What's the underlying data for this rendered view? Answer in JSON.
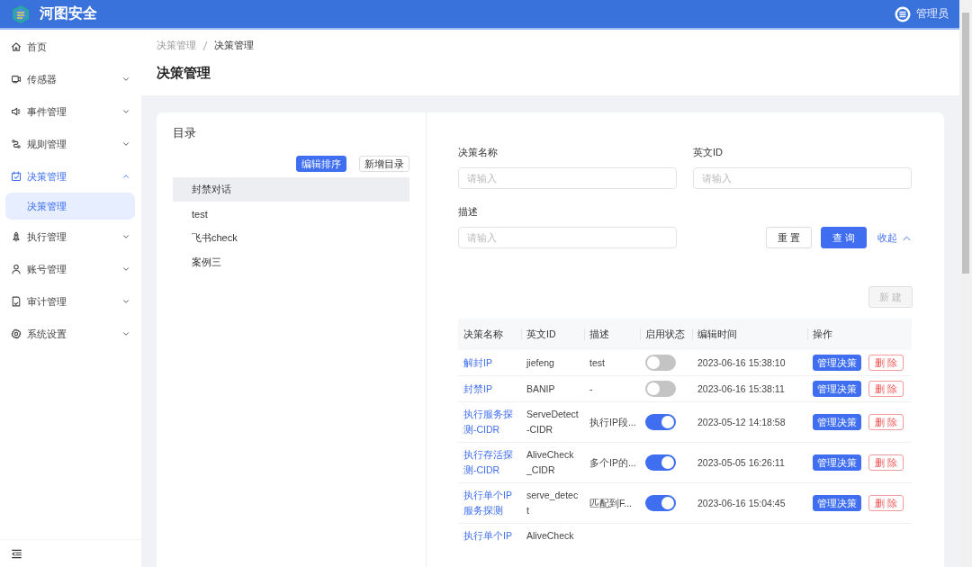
{
  "header": {
    "brand": "河图安全",
    "user": "管理员"
  },
  "sidebar": {
    "items": [
      {
        "label": "首页",
        "selected": false
      },
      {
        "label": "传感器",
        "selected": false,
        "expanded": false
      },
      {
        "label": "事件管理",
        "selected": false,
        "expanded": false
      },
      {
        "label": "规则管理",
        "selected": false,
        "expanded": false
      },
      {
        "label": "决策管理",
        "selected": true,
        "expanded": true,
        "children": [
          {
            "label": "决策管理",
            "selected": true
          }
        ]
      },
      {
        "label": "执行管理",
        "selected": false,
        "expanded": false
      },
      {
        "label": "账号管理",
        "selected": false,
        "expanded": false
      },
      {
        "label": "审计管理",
        "selected": false,
        "expanded": false
      },
      {
        "label": "系统设置",
        "selected": false,
        "expanded": false
      }
    ]
  },
  "breadcrumb": [
    "决策管理",
    "决策管理"
  ],
  "page_title": "决策管理",
  "catalog": {
    "title": "目录",
    "buttons": [
      {
        "label": "编辑排序",
        "kind": "primary"
      },
      {
        "label": "新增目录",
        "kind": "default"
      }
    ],
    "items": [
      {
        "label": "封禁对话",
        "selected": true
      },
      {
        "label": "test",
        "selected": false
      },
      {
        "label": "飞书check",
        "selected": false
      },
      {
        "label": "案例三",
        "selected": false
      }
    ]
  },
  "form": {
    "fields": [
      {
        "label": "决策名称",
        "placeholder": "请输入"
      },
      {
        "label": "英文ID",
        "placeholder": "请输入"
      },
      {
        "label": "描述",
        "placeholder": "请输入"
      }
    ],
    "reset": "重 置",
    "query": "查 询",
    "collapse": "收起"
  },
  "new_button": {
    "label": "新 建",
    "disabled": true
  },
  "table": {
    "columns": [
      "决策名称",
      "英文ID",
      "描述",
      "启用状态",
      "编辑时间",
      "操作"
    ],
    "rows": [
      {
        "name": "解封IP",
        "id": "jiefeng",
        "desc": "test",
        "enabled": false,
        "time": "2023-06-16 15:38:10",
        "manage": "管理决策",
        "delete": "删 除"
      },
      {
        "name": "封禁IP",
        "id": "BANIP",
        "desc": "-",
        "enabled": false,
        "time": "2023-06-16 15:38:11",
        "manage": "管理决策",
        "delete": "删 除"
      },
      {
        "name": "执行服务探测-CIDR",
        "id": "ServeDetect-CIDR",
        "desc": "执行IP段...",
        "enabled": true,
        "time": "2023-05-12 14:18:58",
        "manage": "管理决策",
        "delete": "删 除"
      },
      {
        "name": "执行存活探测-CIDR",
        "id": "AliveCheck_CIDR",
        "desc": "多个IP的...",
        "enabled": true,
        "time": "2023-05-05 16:26:11",
        "manage": "管理决策",
        "delete": "删 除"
      },
      {
        "name": "执行单个IP服务探测",
        "id": "serve_detect",
        "desc": "匹配到F...",
        "enabled": true,
        "time": "2023-06-16 15:04:45",
        "manage": "管理决策",
        "delete": "删 除"
      },
      {
        "name": "执行单个IP",
        "id": "AliveCheck"
      }
    ]
  }
}
